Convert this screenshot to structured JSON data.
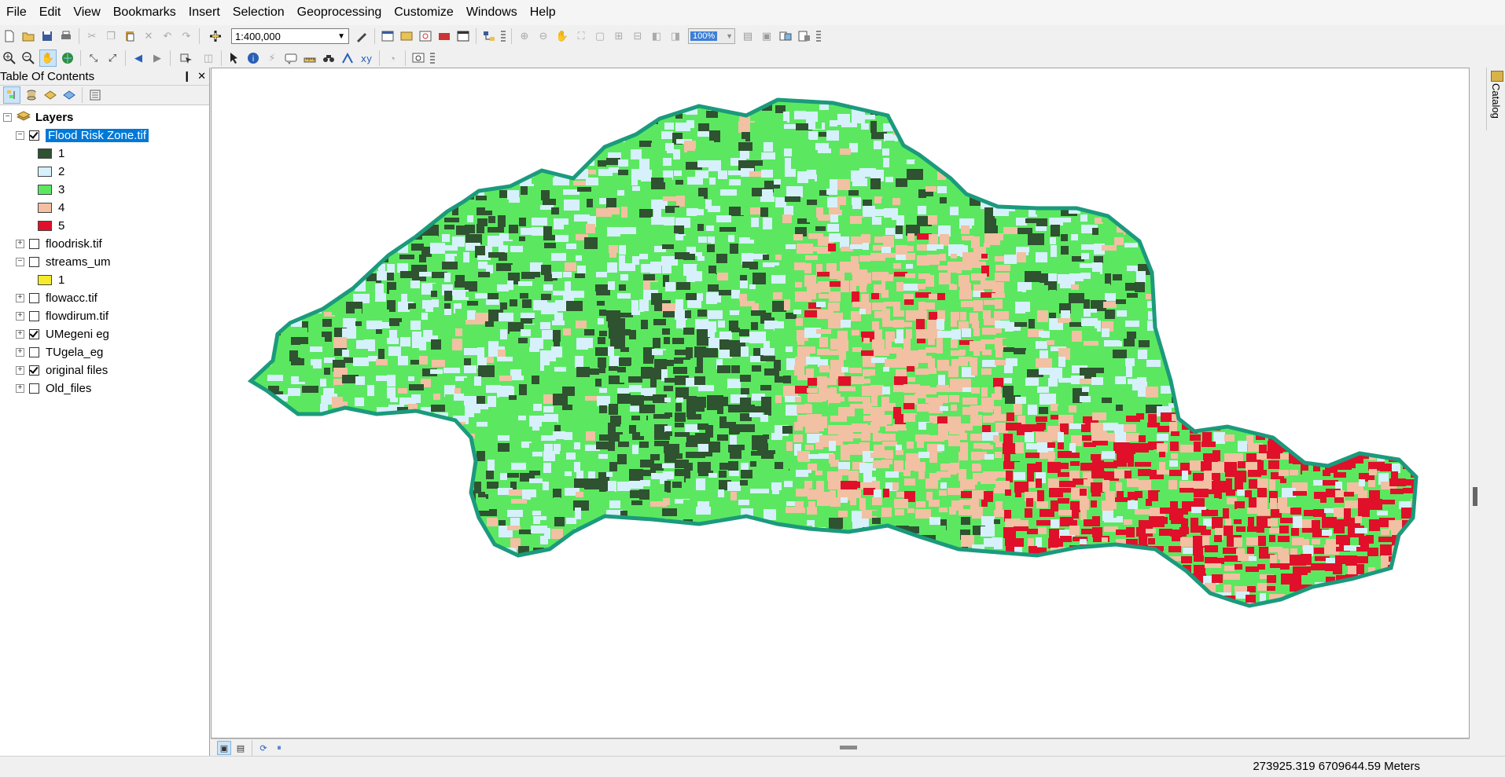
{
  "menu": [
    "File",
    "Edit",
    "View",
    "Bookmarks",
    "Insert",
    "Selection",
    "Geoprocessing",
    "Customize",
    "Windows",
    "Help"
  ],
  "toolbar": {
    "scale_value": "1:400,000",
    "zoom_percent": "100%"
  },
  "toc": {
    "title": "Table Of Contents",
    "pin_label": "❙",
    "close_label": "✕",
    "root": "Layers",
    "layers": [
      {
        "name": "Flood Risk Zone.tif",
        "checked": true,
        "expanded": true,
        "selected": true,
        "classes": [
          {
            "label": "1",
            "color": "#2f5230"
          },
          {
            "label": "2",
            "color": "#d6f1fb"
          },
          {
            "label": "3",
            "color": "#5be860"
          },
          {
            "label": "4",
            "color": "#f2c0a2"
          },
          {
            "label": "5",
            "color": "#e0102a"
          }
        ]
      },
      {
        "name": "floodrisk.tif",
        "checked": false,
        "expanded": false
      },
      {
        "name": "streams_um",
        "checked": false,
        "expanded": true,
        "classes": [
          {
            "label": "1",
            "color": "#f5eb2a"
          }
        ]
      },
      {
        "name": "flowacc.tif",
        "checked": false,
        "expanded": false
      },
      {
        "name": "flowdirum.tif",
        "checked": false,
        "expanded": false
      },
      {
        "name": "UMegeni eg",
        "checked": true,
        "expanded": false
      },
      {
        "name": "TUgela_eg",
        "checked": false,
        "expanded": false
      },
      {
        "name": "original files",
        "checked": true,
        "expanded": false
      },
      {
        "name": "Old_files",
        "checked": false,
        "expanded": false
      }
    ]
  },
  "catalog_tab": "Catalog",
  "status": {
    "coordinates": "273925.319  6709644.59 Meters"
  },
  "map": {
    "outline_color": "#1b9a7c",
    "class_colors": [
      "#2f5230",
      "#d6f1fb",
      "#5be860",
      "#f2c0a2",
      "#e0102a"
    ]
  }
}
